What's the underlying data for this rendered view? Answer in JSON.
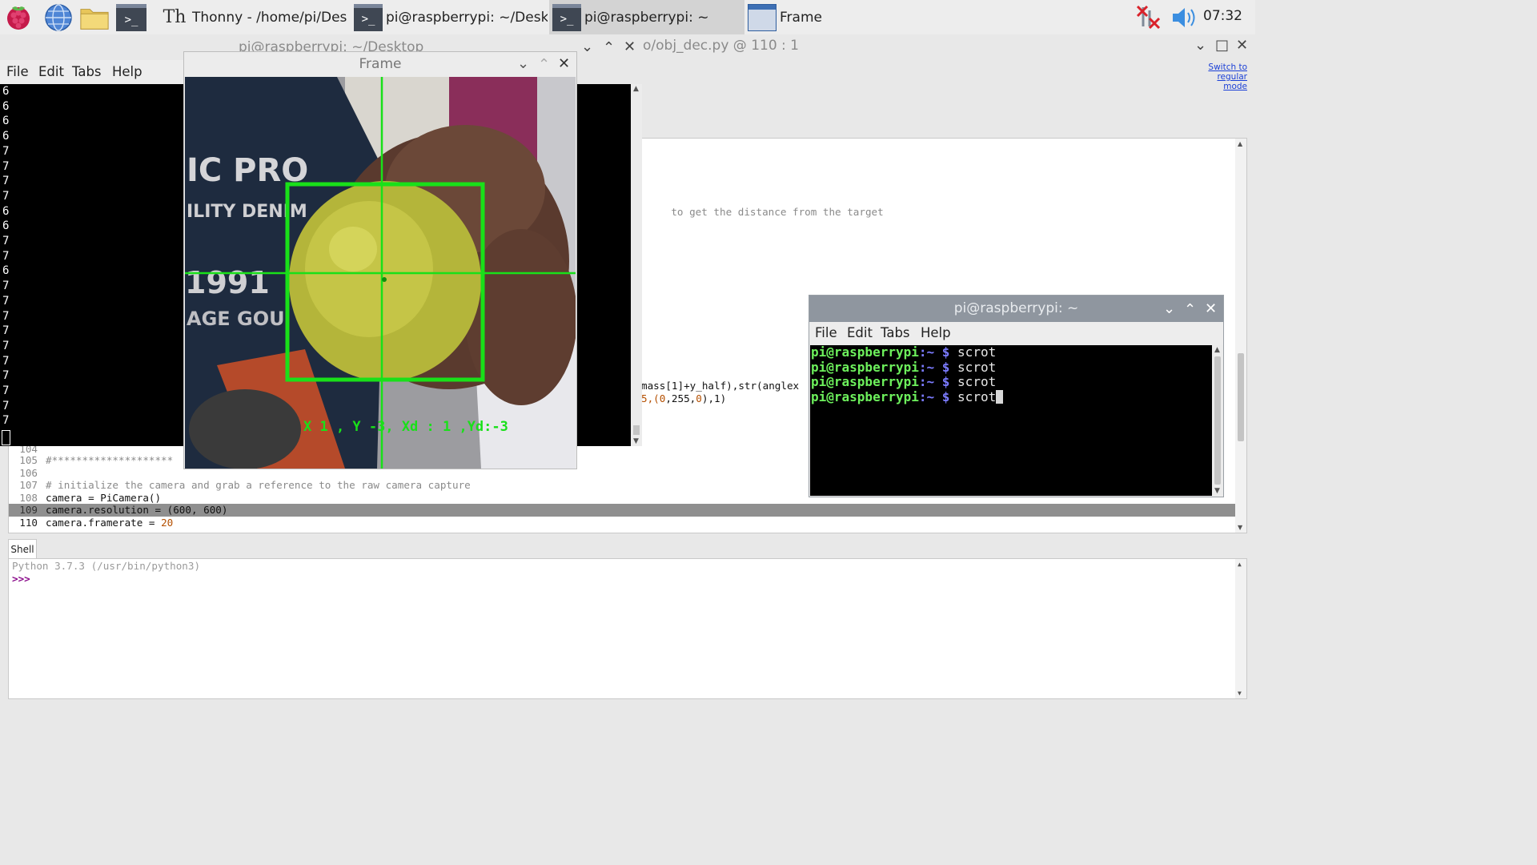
{
  "taskbar": {
    "launchers": [
      "raspberry-menu",
      "web-browser",
      "file-manager",
      "terminal"
    ],
    "tasks": [
      {
        "label": "Thonny  -  /home/pi/Des...",
        "icon": "thonny-icon"
      },
      {
        "label": "pi@raspberrypi: ~/Deskt...",
        "icon": "terminal-icon"
      },
      {
        "label": "pi@raspberrypi: ~",
        "icon": "terminal-icon"
      },
      {
        "label": "Frame",
        "icon": "window-icon"
      }
    ],
    "terminal_glyph": ">_",
    "clock": "07:32"
  },
  "thonny": {
    "title_partial_left": "pi@raspberrypi: ~/Desktop",
    "title_partial_right": "o/obj_dec.py  @  110 : 1",
    "switch_mode": [
      "Switch to",
      "regular",
      "mode"
    ],
    "editor_snippets": {
      "comment_fragment": "to get the distance from the target",
      "putText_line_a": "mass[1]+y_half),str(anglex",
      "putText_line_b_pre": "5,(",
      "putText_line_b_num1": "0",
      "putText_line_b_mid": ",255,",
      "putText_line_b_num2": "0",
      "putText_line_b_post": "),1)"
    },
    "code_lines": [
      {
        "n": "104",
        "text": ""
      },
      {
        "n": "105",
        "text": "#********************"
      },
      {
        "n": "106",
        "text": ""
      },
      {
        "n": "107",
        "text": "# initialize the camera and grab a reference to the raw camera capture"
      },
      {
        "n": "108",
        "text": "camera = PiCamera()"
      },
      {
        "n": "109",
        "text": "camera.resolution = (600, 600)"
      },
      {
        "n": "110",
        "text": "camera.framerate = ",
        "num": "20"
      }
    ],
    "shell_tab": "Shell",
    "shell_banner": "Python 3.7.3 (/usr/bin/python3)",
    "shell_prompt": ">>>"
  },
  "terminal1": {
    "menu": [
      "File",
      "Edit",
      "Tabs",
      "Help"
    ],
    "output_lines": [
      "6",
      "6",
      "6",
      "6",
      "7",
      "7",
      "7",
      "7",
      "6",
      "6",
      "7",
      "7",
      "6",
      "7",
      "7",
      "7",
      "7",
      "7",
      "7",
      "7",
      "7",
      "7",
      "7"
    ]
  },
  "frame": {
    "title": "Frame",
    "overlay_text": "X 1 , Y -3, Xd : 1 ,Yd:-3",
    "colors": {
      "overlay": "#19e019"
    }
  },
  "terminal2": {
    "title": "pi@raspberrypi: ~",
    "menu": [
      "File",
      "Edit",
      "Tabs",
      "Help"
    ],
    "prompt_user": "pi@raspberrypi",
    "prompt_sep": ":~",
    "prompt_dollar": "$",
    "commands": [
      "scrot",
      "scrot",
      "scrot",
      "scrot"
    ]
  },
  "window_controls": {
    "minimize": "⌄",
    "maximize": "⌃",
    "close": "✕",
    "restore": "□"
  }
}
